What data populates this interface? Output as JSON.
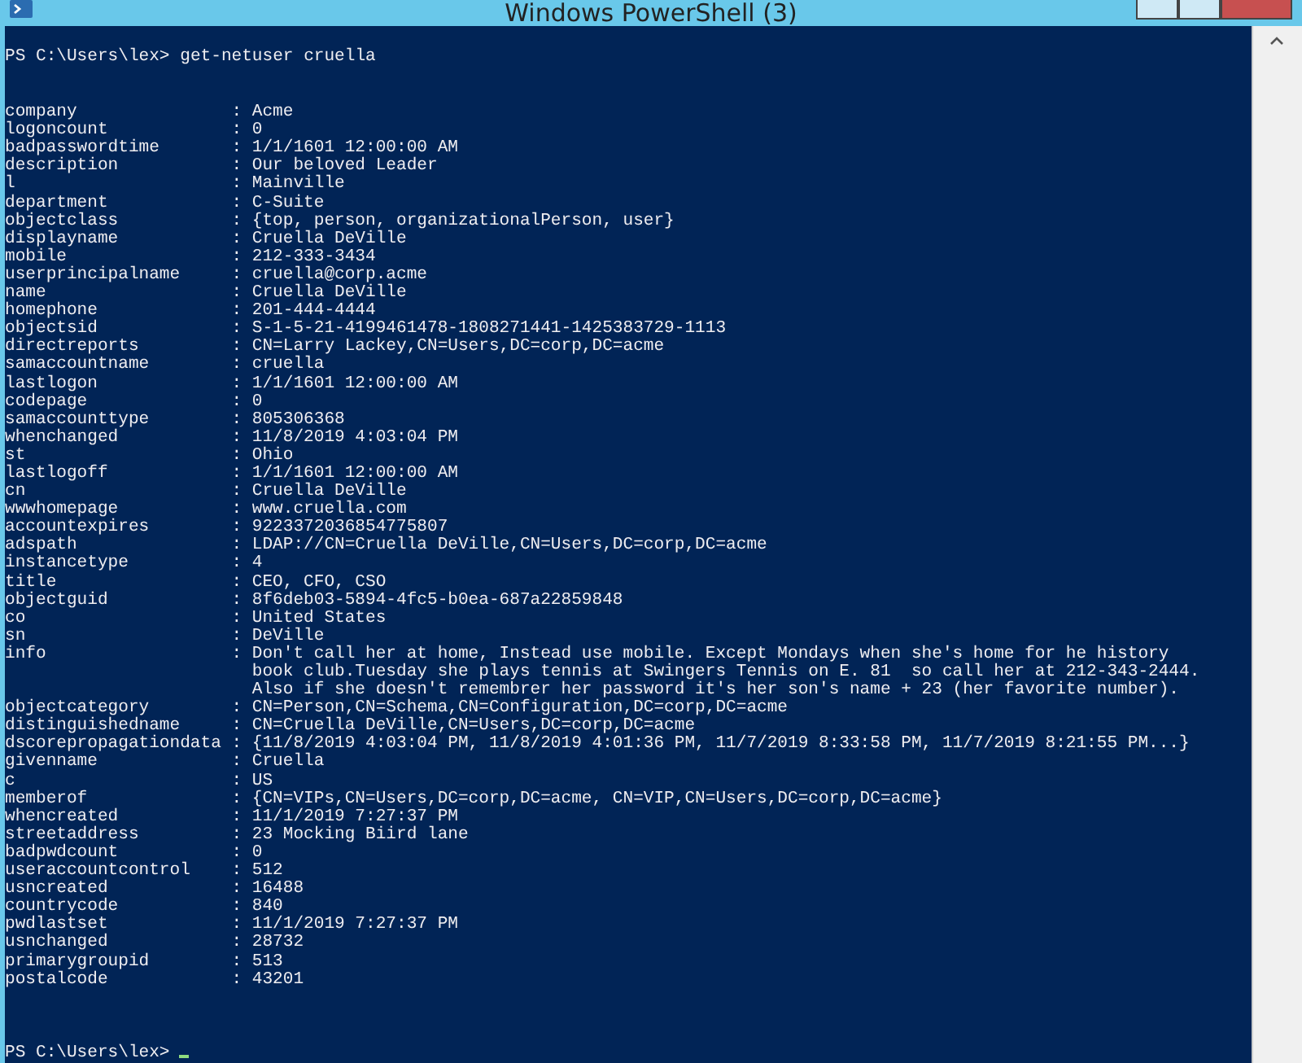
{
  "window": {
    "title": "Windows PowerShell (3)"
  },
  "console": {
    "command_line": {
      "prompt": "PS C:\\Users\\lex>",
      "command": "get-netuser cruella"
    },
    "properties": [
      {
        "name": "company",
        "lines": [
          "Acme"
        ]
      },
      {
        "name": "logoncount",
        "lines": [
          "0"
        ]
      },
      {
        "name": "badpasswordtime",
        "lines": [
          "1/1/1601 12:00:00 AM"
        ]
      },
      {
        "name": "description",
        "lines": [
          "Our beloved Leader"
        ]
      },
      {
        "name": "l",
        "lines": [
          "Mainville"
        ]
      },
      {
        "name": "department",
        "lines": [
          "C-Suite"
        ]
      },
      {
        "name": "objectclass",
        "lines": [
          "{top, person, organizationalPerson, user}"
        ]
      },
      {
        "name": "displayname",
        "lines": [
          "Cruella DeVille"
        ]
      },
      {
        "name": "mobile",
        "lines": [
          "212-333-3434"
        ]
      },
      {
        "name": "userprincipalname",
        "lines": [
          "cruella@corp.acme"
        ]
      },
      {
        "name": "name",
        "lines": [
          "Cruella DeVille"
        ]
      },
      {
        "name": "homephone",
        "lines": [
          "201-444-4444"
        ]
      },
      {
        "name": "objectsid",
        "lines": [
          "S-1-5-21-4199461478-1808271441-1425383729-1113"
        ]
      },
      {
        "name": "directreports",
        "lines": [
          "CN=Larry Lackey,CN=Users,DC=corp,DC=acme"
        ]
      },
      {
        "name": "samaccountname",
        "lines": [
          "cruella"
        ]
      },
      {
        "name": "lastlogon",
        "lines": [
          "1/1/1601 12:00:00 AM"
        ]
      },
      {
        "name": "codepage",
        "lines": [
          "0"
        ]
      },
      {
        "name": "samaccounttype",
        "lines": [
          "805306368"
        ]
      },
      {
        "name": "whenchanged",
        "lines": [
          "11/8/2019 4:03:04 PM"
        ]
      },
      {
        "name": "st",
        "lines": [
          "Ohio"
        ]
      },
      {
        "name": "lastlogoff",
        "lines": [
          "1/1/1601 12:00:00 AM"
        ]
      },
      {
        "name": "cn",
        "lines": [
          "Cruella DeVille"
        ]
      },
      {
        "name": "wwwhomepage",
        "lines": [
          "www.cruella.com"
        ]
      },
      {
        "name": "accountexpires",
        "lines": [
          "9223372036854775807"
        ]
      },
      {
        "name": "adspath",
        "lines": [
          "LDAP://CN=Cruella DeVille,CN=Users,DC=corp,DC=acme"
        ]
      },
      {
        "name": "instancetype",
        "lines": [
          "4"
        ]
      },
      {
        "name": "title",
        "lines": [
          "CEO, CFO, CSO"
        ]
      },
      {
        "name": "objectguid",
        "lines": [
          "8f6deb03-5894-4fc5-b0ea-687a22859848"
        ]
      },
      {
        "name": "co",
        "lines": [
          "United States"
        ]
      },
      {
        "name": "sn",
        "lines": [
          "DeVille"
        ]
      },
      {
        "name": "info",
        "lines": [
          "Don't call her at home, Instead use mobile. Except Mondays when she's home for he history",
          "book club.Tuesday she plays tennis at Swingers Tennis on E. 81  so call her at 212-343-2444.",
          "Also if she doesn't remembrer her password it's her son's name + 23 (her favorite number)."
        ]
      },
      {
        "name": "objectcategory",
        "lines": [
          "CN=Person,CN=Schema,CN=Configuration,DC=corp,DC=acme"
        ]
      },
      {
        "name": "distinguishedname",
        "lines": [
          "CN=Cruella DeVille,CN=Users,DC=corp,DC=acme"
        ]
      },
      {
        "name": "dscorepropagationdata",
        "lines": [
          "{11/8/2019 4:03:04 PM, 11/8/2019 4:01:36 PM, 11/7/2019 8:33:58 PM, 11/7/2019 8:21:55 PM...}"
        ]
      },
      {
        "name": "givenname",
        "lines": [
          "Cruella"
        ]
      },
      {
        "name": "c",
        "lines": [
          "US"
        ]
      },
      {
        "name": "memberof",
        "lines": [
          "{CN=VIPs,CN=Users,DC=corp,DC=acme, CN=VIP,CN=Users,DC=corp,DC=acme}"
        ]
      },
      {
        "name": "whencreated",
        "lines": [
          "11/1/2019 7:27:37 PM"
        ]
      },
      {
        "name": "streetaddress",
        "lines": [
          "23 Mocking Biird lane"
        ]
      },
      {
        "name": "badpwdcount",
        "lines": [
          "0"
        ]
      },
      {
        "name": "useraccountcontrol",
        "lines": [
          "512"
        ]
      },
      {
        "name": "usncreated",
        "lines": [
          "16488"
        ]
      },
      {
        "name": "countrycode",
        "lines": [
          "840"
        ]
      },
      {
        "name": "pwdlastset",
        "lines": [
          "11/1/2019 7:27:37 PM"
        ]
      },
      {
        "name": "usnchanged",
        "lines": [
          "28732"
        ]
      },
      {
        "name": "primarygroupid",
        "lines": [
          "513"
        ]
      },
      {
        "name": "postalcode",
        "lines": [
          "43201"
        ]
      }
    ],
    "separator": ":",
    "final_prompt": "PS C:\\Users\\lex>"
  }
}
